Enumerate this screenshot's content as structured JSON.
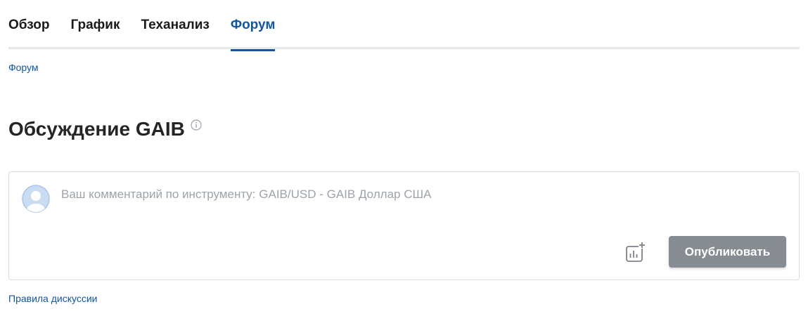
{
  "tabs": [
    {
      "label": "Обзор",
      "active": false
    },
    {
      "label": "График",
      "active": false
    },
    {
      "label": "Теханализ",
      "active": false
    },
    {
      "label": "Форум",
      "active": true
    }
  ],
  "breadcrumb": "Форум",
  "page_title": "Обсуждение GAIB",
  "comment": {
    "placeholder": "Ваш комментарий по инструменту: GAIB/USD - GAIB Доллар США",
    "value": "",
    "publish_label": "Опубликовать"
  },
  "rules_link": "Правила дискуссии",
  "icons": {
    "info": "info-icon",
    "avatar": "user-avatar-icon",
    "attach_chart": "chart-add-icon"
  },
  "colors": {
    "accent": "#1256a0",
    "button_disabled": "#878c92",
    "placeholder": "#9ca3ab",
    "divider": "#e6e9eb"
  }
}
